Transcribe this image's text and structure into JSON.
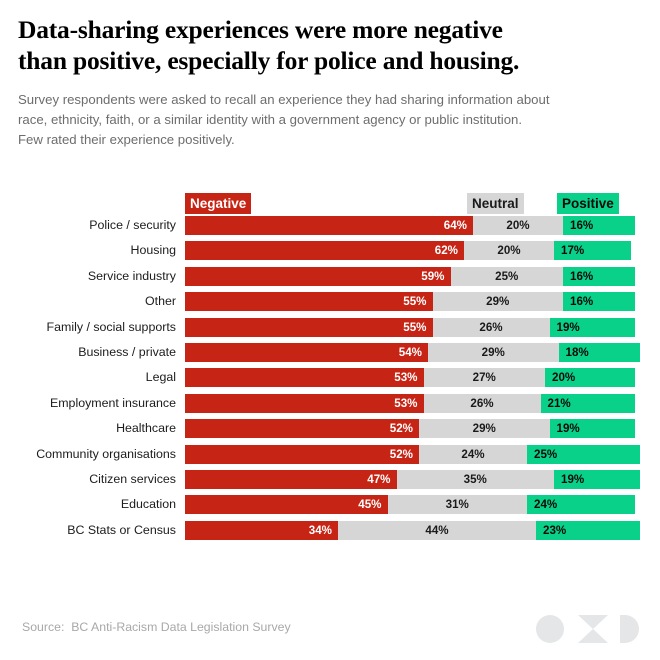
{
  "header": {
    "title": "Data-sharing experiences were more negative\nthan positive, especially for police and housing.",
    "subtitle": "Survey respondents were asked to recall an experience they had sharing information about\nrace, ethnicity, faith, or a similar identity with a government agency or public institution.\nFew rated their experience positively."
  },
  "legend": {
    "negative_label": "Negative",
    "neutral_label": "Neutral",
    "positive_label": "Positive"
  },
  "footer": {
    "source_label": "Source:",
    "source_value": "BC Anti-Racism Data Legislation Survey",
    "source_full": "Source:  BC Anti-Racism Data Legislation Survey",
    "logo_name": "oxd-logo"
  },
  "colors": {
    "negative": "#c62414",
    "neutral": "#d6d6d6",
    "positive": "#09d189",
    "title": "#000000",
    "subtitle": "#6d6d6d",
    "source": "#a8a8a8",
    "logo": "#e4e6e7"
  },
  "chart_data": {
    "type": "bar",
    "subtype": "stacked-horizontal-100",
    "title": "Data-sharing experiences were more negative than positive, especially for police and housing.",
    "subtitle": "Survey respondents were asked to recall an experience they had sharing information about race, ethnicity, faith, or a similar identity with a government agency or public institution. Few rated their experience positively.",
    "xlabel": "",
    "ylabel": "",
    "xlim": [
      0,
      100
    ],
    "grid": false,
    "legend_position": "top",
    "value_suffix": "%",
    "categories": [
      "Police / security",
      "Housing",
      "Service industry",
      "Other",
      "Family / social supports",
      "Business / private",
      "Legal",
      "Employment insurance",
      "Healthcare",
      "Community organisations",
      "Citizen services",
      "Education",
      "BC Stats or Census"
    ],
    "series": [
      {
        "name": "Negative",
        "color": "#c62414",
        "values": [
          64,
          62,
          59,
          55,
          55,
          54,
          53,
          53,
          52,
          52,
          47,
          45,
          34
        ]
      },
      {
        "name": "Neutral",
        "color": "#d6d6d6",
        "values": [
          20,
          20,
          25,
          29,
          26,
          29,
          27,
          26,
          29,
          24,
          35,
          31,
          44
        ]
      },
      {
        "name": "Positive",
        "color": "#09d189",
        "values": [
          16,
          17,
          16,
          16,
          19,
          18,
          20,
          21,
          19,
          25,
          19,
          24,
          23
        ]
      }
    ],
    "rows": [
      {
        "label": "Police / security",
        "negative": 64,
        "neutral": 20,
        "positive": 16,
        "negative_text": "64%",
        "neutral_text": "20%",
        "positive_text": "16%"
      },
      {
        "label": "Housing",
        "negative": 62,
        "neutral": 20,
        "positive": 17,
        "negative_text": "62%",
        "neutral_text": "20%",
        "positive_text": "17%"
      },
      {
        "label": "Service industry",
        "negative": 59,
        "neutral": 25,
        "positive": 16,
        "negative_text": "59%",
        "neutral_text": "25%",
        "positive_text": "16%"
      },
      {
        "label": "Other",
        "negative": 55,
        "neutral": 29,
        "positive": 16,
        "negative_text": "55%",
        "neutral_text": "29%",
        "positive_text": "16%"
      },
      {
        "label": "Family / social supports",
        "negative": 55,
        "neutral": 26,
        "positive": 19,
        "negative_text": "55%",
        "neutral_text": "26%",
        "positive_text": "19%"
      },
      {
        "label": "Business / private",
        "negative": 54,
        "neutral": 29,
        "positive": 18,
        "negative_text": "54%",
        "neutral_text": "29%",
        "positive_text": "18%"
      },
      {
        "label": "Legal",
        "negative": 53,
        "neutral": 27,
        "positive": 20,
        "negative_text": "53%",
        "neutral_text": "27%",
        "positive_text": "20%"
      },
      {
        "label": "Employment insurance",
        "negative": 53,
        "neutral": 26,
        "positive": 21,
        "negative_text": "53%",
        "neutral_text": "26%",
        "positive_text": "21%"
      },
      {
        "label": "Healthcare",
        "negative": 52,
        "neutral": 29,
        "positive": 19,
        "negative_text": "52%",
        "neutral_text": "29%",
        "positive_text": "19%"
      },
      {
        "label": "Community organisations",
        "negative": 52,
        "neutral": 24,
        "positive": 25,
        "negative_text": "52%",
        "neutral_text": "24%",
        "positive_text": "25%"
      },
      {
        "label": "Citizen services",
        "negative": 47,
        "neutral": 35,
        "positive": 19,
        "negative_text": "47%",
        "neutral_text": "35%",
        "positive_text": "19%"
      },
      {
        "label": "Education",
        "negative": 45,
        "neutral": 31,
        "positive": 24,
        "negative_text": "45%",
        "neutral_text": "31%",
        "positive_text": "24%"
      },
      {
        "label": "BC Stats or Census",
        "negative": 34,
        "neutral": 44,
        "positive": 23,
        "negative_text": "34%",
        "neutral_text": "44%",
        "positive_text": "23%"
      }
    ]
  }
}
